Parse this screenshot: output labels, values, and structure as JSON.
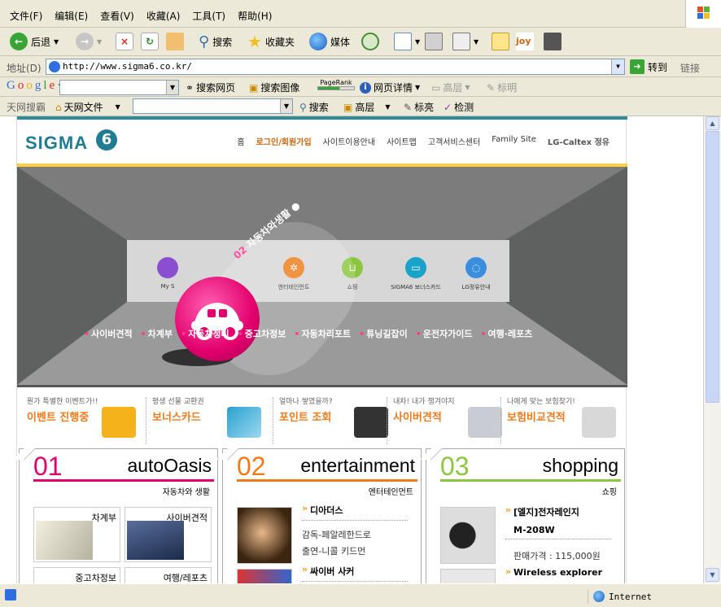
{
  "menubar": {
    "items": [
      "文件(F)",
      "编辑(E)",
      "查看(V)",
      "收藏(A)",
      "工具(T)",
      "帮助(H)"
    ]
  },
  "toolbar": {
    "back": "后退",
    "search": "搜索",
    "favorites": "收藏夹",
    "media": "媒体"
  },
  "address": {
    "label": "地址(D)",
    "url": "http://www.sigma6.co.kr/",
    "go": "转到",
    "links": "链接"
  },
  "google": {
    "search_web": "搜索网页",
    "search_images": "搜索图像",
    "pagerank": "PageRank",
    "page_info": "网页详情",
    "up": "高层",
    "highlight": "标明"
  },
  "tianwang": {
    "label": "天网搜霸",
    "files": "天网文件",
    "search": "搜索",
    "up": "高层",
    "highlight": "标亮",
    "check": "检测"
  },
  "site": {
    "logo": "SIGMA",
    "logo_num": "6",
    "nav": [
      "홈",
      "로그인/회원가입",
      "사이트이용안내",
      "사이트맵",
      "고객서비스센터",
      "Family Site",
      "LG-Caltex 정유"
    ],
    "hero": {
      "number": "02",
      "subtitle": "자동차와생활",
      "categories": [
        "My S",
        "엔터테인먼트",
        "쇼핑",
        "SIGMA6 보너스카드",
        "LG정유안내"
      ],
      "menu": [
        "사이버견적",
        "차계부",
        "자동차정비",
        "중고차정보",
        "자동차리포트",
        "튜닝길잡이",
        "운전자가이드",
        "여행·레포츠"
      ]
    },
    "promos": [
      {
        "small": "뭔가 특별한 이벤트가!!",
        "title": "이벤트 진행중"
      },
      {
        "small": "평생 선물 교환권",
        "title": "보너스카드"
      },
      {
        "small": "얼마나 쌓였을까?",
        "title": "포인트 조회"
      },
      {
        "small": "내차! 내가 챙겨야지",
        "title": "사이버견적"
      },
      {
        "small": "나에게 맞는 보험찾기!",
        "title": "보험비교견적"
      }
    ],
    "sections": [
      {
        "num": "01",
        "title": "autoOasis",
        "sub": "자동차와 생활",
        "tiles": [
          "차계부",
          "사이버견적",
          "중고차정보",
          "여행/레포츠"
        ]
      },
      {
        "num": "02",
        "title": "entertainment",
        "sub": "엔터테인먼트",
        "items": [
          {
            "title": "디아더스",
            "lines": [
              "감독-페알레한드로",
              "출연-니콜 키드먼"
            ]
          },
          {
            "title": "싸이버 사커",
            "lines": []
          }
        ]
      },
      {
        "num": "03",
        "title": "shopping",
        "sub": "쇼핑",
        "items": [
          {
            "title": "[엘지]전자레인지",
            "lines": [
              "M-208W",
              "판매가격 : 115,000원"
            ]
          },
          {
            "title": "Wireless explorer",
            "lines": []
          }
        ]
      }
    ]
  },
  "status": {
    "zone": "Internet"
  },
  "colors": {
    "teal": "#1f7c92",
    "pink": "#e2006c",
    "orange": "#f07a1a",
    "green": "#8cc63f",
    "yellow": "#ffcf3f"
  }
}
